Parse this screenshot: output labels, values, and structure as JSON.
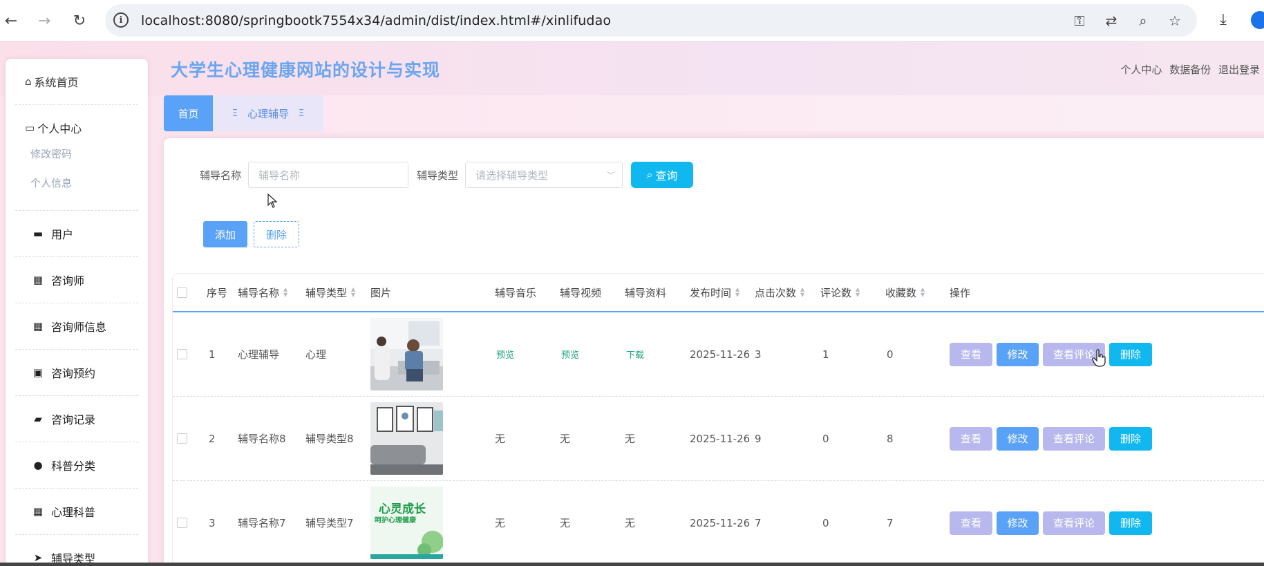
{
  "browser": {
    "url": "localhost:8080/springbootk7554x34/admin/dist/index.html#/xinlifudao"
  },
  "header": {
    "title": "大学生心理健康网站的设计与实现",
    "links": [
      "个人中心",
      "数据备份",
      "退出登录"
    ]
  },
  "sidebar": {
    "home": "系统首页",
    "personal": "个人中心",
    "personal_sub": [
      "修改密码",
      "个人信息"
    ],
    "items": [
      {
        "label": "用户",
        "icon": "monitor-icon"
      },
      {
        "label": "咨询师",
        "icon": "grid-icon"
      },
      {
        "label": "咨询师信息",
        "icon": "grid-icon"
      },
      {
        "label": "咨询预约",
        "icon": "clipboard-icon"
      },
      {
        "label": "咨询记录",
        "icon": "wallet-icon"
      },
      {
        "label": "科普分类",
        "icon": "user-icon"
      },
      {
        "label": "心理科普",
        "icon": "grid-icon"
      },
      {
        "label": "辅导类型",
        "icon": "send-icon"
      }
    ]
  },
  "tabs": {
    "home": "首页",
    "current": "心理辅导"
  },
  "search": {
    "name_label": "辅导名称",
    "name_placeholder": "辅导名称",
    "type_label": "辅导类型",
    "type_placeholder": "请选择辅导类型",
    "query_button": "查询"
  },
  "actions": {
    "add": "添加",
    "delete": "删除"
  },
  "table": {
    "columns": [
      "序号",
      "辅导名称",
      "辅导类型",
      "图片",
      "辅导音乐",
      "辅导视频",
      "辅导资料",
      "发布时间",
      "点击次数",
      "评论数",
      "收藏数",
      "操作"
    ],
    "rows": [
      {
        "index": "1",
        "name": "心理辅导",
        "type": "心理",
        "music": "预览",
        "video": "预览",
        "material": "下载",
        "date": "2025-11-26",
        "clicks": "3",
        "comments": "1",
        "favorites": "0"
      },
      {
        "index": "2",
        "name": "辅导名称8",
        "type": "辅导类型8",
        "music": "无",
        "video": "无",
        "material": "无",
        "date": "2025-11-26",
        "clicks": "9",
        "comments": "0",
        "favorites": "8"
      },
      {
        "index": "3",
        "name": "辅导名称7",
        "type": "辅导类型7",
        "music": "无",
        "video": "无",
        "material": "无",
        "date": "2025-11-26",
        "clicks": "7",
        "comments": "0",
        "favorites": "7"
      }
    ],
    "row_actions": {
      "view": "查看",
      "edit": "修改",
      "comments": "查看评论",
      "delete": "删除"
    },
    "thumb3_text": [
      "心灵成长",
      "呵护心理健康"
    ]
  },
  "colors": {
    "primary": "#5aa2f7",
    "accent": "#11b8f0",
    "muted_button": "#b9b8ee",
    "title": "#6aa6f0"
  }
}
